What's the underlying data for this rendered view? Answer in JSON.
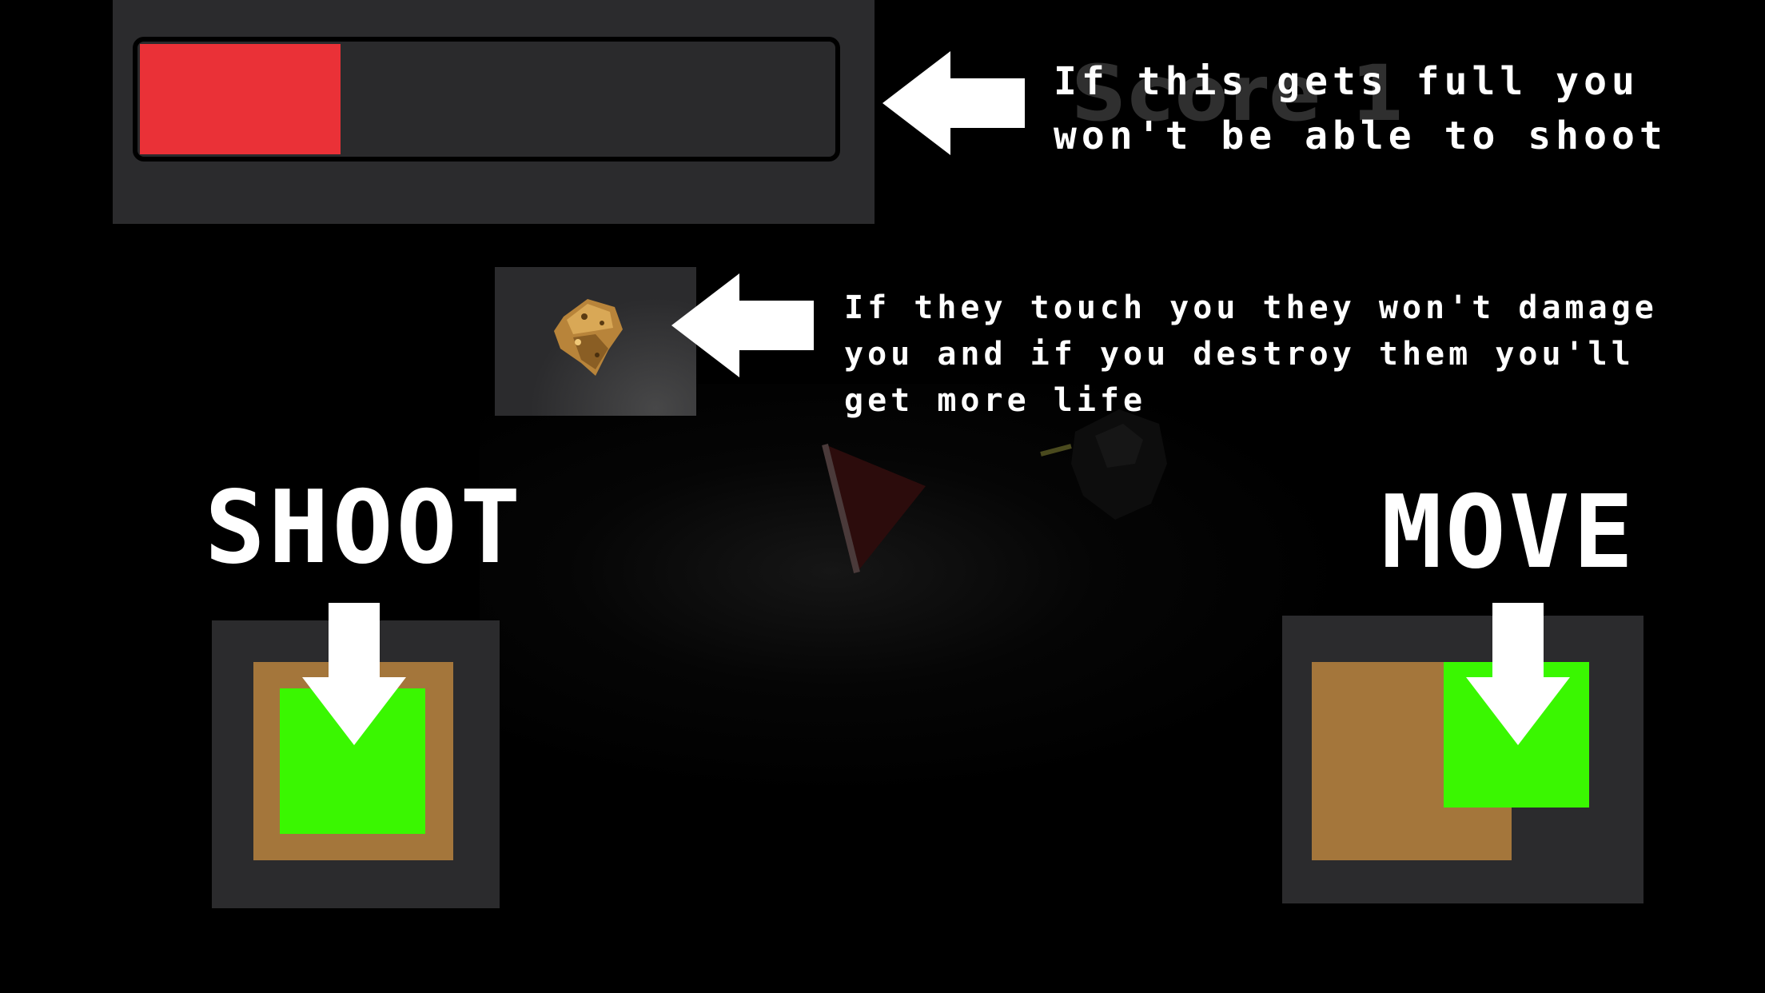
{
  "overheat_bar": {
    "fill_fraction": 0.29,
    "fill_color": "#ea3137",
    "track_color": "#2a2a2c"
  },
  "hints": {
    "overheat": "If this gets full you\nwon't be able to shoot",
    "pickup": "If they touch you they won't damage\nyou and if you destroy them you'll\nget more life"
  },
  "background_score_text": "Score 1",
  "controls": {
    "shoot_label": "SHOOT",
    "move_label": "MOVE"
  },
  "colors": {
    "panel": "#2b2b2d",
    "joystick_base": "#a4763b",
    "joystick_knob": "#3af701",
    "text": "#ffffff"
  },
  "icons": {
    "pickup": "golden-rock-icon",
    "arrows": "white-arrow-icon",
    "player": "red-triangle-ship-icon",
    "enemy": "dark-asteroid-icon"
  }
}
